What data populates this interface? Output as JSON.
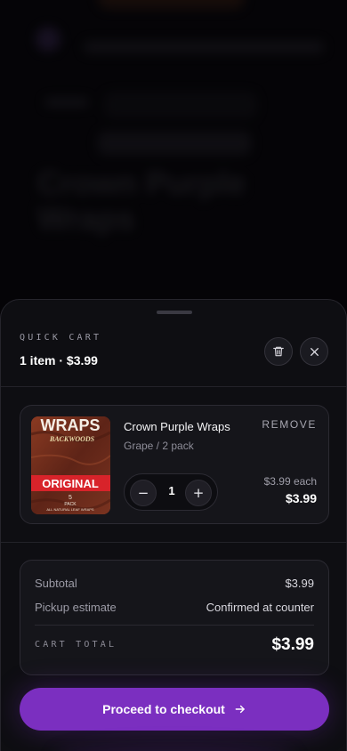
{
  "cart": {
    "eyebrow": "QUICK CART",
    "summary": "1 item · $3.99"
  },
  "item": {
    "name": "Crown Purple Wraps",
    "variant": "Grape / 2 pack",
    "remove_label": "REMOVE",
    "quantity": "1",
    "each_price": "$3.99 each",
    "line_total": "$3.99",
    "thumbnail": {
      "brand": "WRAPS",
      "sub_brand": "BACKWOODS",
      "flavor": "ORIGINAL",
      "count": "5",
      "count_label": "PACK",
      "tagline": "ALL NATURAL LEAF WRAPS"
    }
  },
  "totals": {
    "subtotal_label": "Subtotal",
    "subtotal_value": "$3.99",
    "pickup_label": "Pickup estimate",
    "pickup_value": "Confirmed at counter",
    "total_label": "CART TOTAL",
    "total_value": "$3.99"
  },
  "checkout": {
    "label": "Proceed to checkout"
  },
  "background": {
    "title": "Crown Purple Wraps"
  },
  "colors": {
    "accent": "#7b2fc0",
    "sheet": "#0e0e12",
    "card": "#15151a"
  },
  "icons": {
    "trash": "trash-icon",
    "close": "close-icon",
    "minus": "minus-icon",
    "plus": "plus-icon",
    "arrow": "arrow-right-icon"
  }
}
